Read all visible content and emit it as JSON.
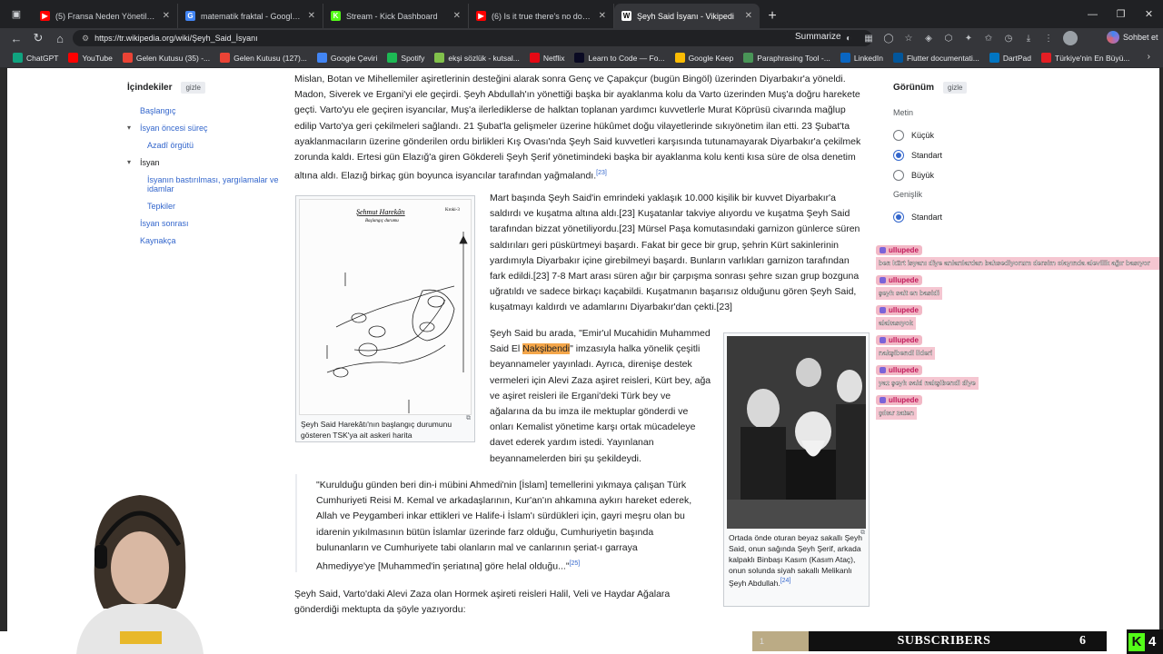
{
  "browser": {
    "tabs": [
      {
        "label": "(5) Fransa Neden Yönetilemiyor?",
        "favicon_color": "#ff0000",
        "favicon": "▶"
      },
      {
        "label": "matematik fraktal - Google'da Ar",
        "favicon_color": "#4285f4",
        "favicon": "G"
      },
      {
        "label": "Stream - Kick Dashboard",
        "favicon_color": "#53fc18",
        "favicon": "K"
      },
      {
        "label": "(6) Is it true there's no document",
        "favicon_color": "#ff0000",
        "favicon": "▶"
      },
      {
        "label": "Şeyh Said İsyanı - Vikipedi",
        "favicon_color": "#ffffff",
        "favicon": "W"
      }
    ],
    "url": "https://tr.wikipedia.org/wiki/Şeyh_Said_İsyanı",
    "summarize_label": "Summarize",
    "chat_label": "Sohbet et"
  },
  "bookmarks": [
    {
      "label": "ChatGPT",
      "color": "#10a37f"
    },
    {
      "label": "YouTube",
      "color": "#ff0000"
    },
    {
      "label": "Gelen Kutusu (35) -...",
      "color": "#ea4335"
    },
    {
      "label": "Gelen Kutusu (127)...",
      "color": "#ea4335"
    },
    {
      "label": "Google Çeviri",
      "color": "#4285f4"
    },
    {
      "label": "Spotify",
      "color": "#1db954"
    },
    {
      "label": "ekşi sözlük - kutsal...",
      "color": "#81c14b"
    },
    {
      "label": "Netflix",
      "color": "#e50914"
    },
    {
      "label": "Learn to Code — Fo...",
      "color": "#0a0a23"
    },
    {
      "label": "Google Keep",
      "color": "#fbbc04"
    },
    {
      "label": "Paraphrasing Tool -...",
      "color": "#499557"
    },
    {
      "label": "LinkedIn",
      "color": "#0a66c2"
    },
    {
      "label": "Flutter documentati...",
      "color": "#02569b"
    },
    {
      "label": "DartPad",
      "color": "#0175c2"
    },
    {
      "label": "Türkiye'nin En Büyü...",
      "color": "#e31e24"
    }
  ],
  "toc": {
    "title": "İçindekiler",
    "hide": "gizle",
    "items": [
      {
        "label": "Başlangıç",
        "level": 0
      },
      {
        "label": "İsyan öncesi süreç",
        "level": 0,
        "caret": "▾"
      },
      {
        "label": "Azadî örgütü",
        "level": 1
      },
      {
        "label": "İsyan",
        "level": 0,
        "caret": "▾"
      },
      {
        "label": "İsyanın bastırılması, yargılamalar ve idamlar",
        "level": 1
      },
      {
        "label": "Tepkiler",
        "level": 1
      },
      {
        "label": "İsyan sonrası",
        "level": 0
      },
      {
        "label": "Kaynakça",
        "level": 0
      }
    ]
  },
  "article": {
    "p1": "Mislan, Botan ve Mihellemiler aşiretlerinin desteğini alarak sonra Genç ve Çapakçur (bugün Bingöl) üzerinden Diyarbakır'a yöneldi. Madon, Siverek ve Ergani'yi ele geçirdi. Şeyh Abdullah'ın yönettiği başka bir ayaklanma kolu da Varto üzerinden Muş'a doğru harekete geçti. Varto'yu ele geçiren isyancılar, Muş'a ilerlediklerse de halktan toplanan yardımcı kuvvetlerle Murat Köprüsü civarında mağlup edilip Varto'ya geri çekilmeleri sağlandı. 21 Şubat'la gelişmeler üzerine hükûmet doğu vilayetlerinde sıkıyönetim ilan etti. 23 Şubat'ta ayaklanmacıların üzerine gönderilen ordu birlikleri Kış Ovası'nda Şeyh Said kuvvetleri karşısında tutunamayarak Diyarbakır'a çekilmek zorunda kaldı. Ertesi gün Elazığ'a giren Gökdereli Şeyh Şerif yönetimindeki başka bir ayaklanma kolu kenti kısa süre de olsa denetim altına aldı. Elazığ birkaç gün boyunca isyancılar tarafından yağmalandı.",
    "p1_ref": "[23]",
    "p2": "Mart başında Şeyh Said'in emrindeki yaklaşık 10.000 kişilik bir kuvvet Diyarbakır'a saldırdı ve kuşatma altına aldı.[23] Kuşatanlar takviye alıyordu ve kuşatma Şeyh Said tarafından bizzat yönetiliyordu.[23] Mürsel Paşa komutasındaki garnizon günlerce süren saldırıları geri püskürtmeyi başardı. Fakat bir gece bir grup, şehrin Kürt sakinlerinin yardımıyla Diyarbakır içine girebilmeyi başardı. Bunların varlıkları garnizon tarafından fark edildi.[23] 7-8 Mart arası süren ağır bir çarpışma sonrası şehre sızan grup bozguna uğratıldı ve sadece birkaçı kaçabildi. Kuşatmanın başarısız olduğunu gören Şeyh Said, kuşatmayı kaldırdı ve adamlarını Diyarbakır'dan çekti.[23]",
    "p3_pre": "Şeyh Said bu arada, \"Emir'ul Mucahidin Muhammed Said El ",
    "p3_hl": "Nakşibendi",
    "p3_post": "\" imzasıyla halka yönelik çeşitli beyannameler yayınladı. Ayrıca, direnişe destek vermeleri için Alevi Zaza aşiret reisleri, Kürt bey, ağa ve aşiret reisleri ile Ergani'deki Türk bey ve ağalarına da bu imza ile mektuplar gönderdi ve onları Kemalist yönetime karşı ortak mücadeleye davet ederek yardım istedi. Yayınlanan beyannamelerden biri şu şekildeydi.",
    "quote": "\"Kurulduğu günden beri din-i mübini Ahmedi'nin [İslam] temellerini yıkmaya çalışan Türk Cumhuriyeti Reisi M. Kemal ve arkadaşlarının, Kur'an'ın ahkamına aykırı hareket ederek, Allah ve Peygamberi inkar ettikleri ve Halife-i İslam'ı sürdükleri için, gayri meşru olan bu idarenin yıkılmasının bütün İslamlar üzerinde farz olduğu, Cumhuriyetin başında bulunanların ve Cumhuriyete tabi olanların mal ve canlarının şeriat-ı garraya Ahmediyye'ye [Muhammed'in şeriatına] göre helal olduğu...\"",
    "quote_ref": "[25]",
    "p4": "Şeyh Said, Varto'daki Alevi Zaza olan Hormek aşireti reisleri Halil, Veli ve Haydar Ağalara gönderdiği mektupta da şöyle yazıyordu:",
    "fig1_caption": "Şeyh Said Harekâtı'nın başlangıç durumunu gösteren TSK'ya ait askeri harita",
    "fig1_map_title": "Şehmut Harekâtı",
    "fig1_map_sub": "Başlangıç durumu",
    "fig1_map_num": "Kroki-3",
    "fig2_caption": "Ortada önde oturan beyaz sakallı Şeyh Said, onun sağında Şeyh Şerif, arkada kalpaklı Binbaşı Kasım (Kasım Ataç), onun solunda siyah sakallı Melikanlı Şeyh Abdullah.",
    "fig2_ref": "[24]"
  },
  "appearance": {
    "title": "Görünüm",
    "hide": "gizle",
    "text_section": "Metin",
    "text_options": [
      {
        "label": "Küçük",
        "selected": false
      },
      {
        "label": "Standart",
        "selected": true
      },
      {
        "label": "Büyük",
        "selected": false
      }
    ],
    "width_section": "Genişlik",
    "width_options": [
      {
        "label": "Standart",
        "selected": true
      }
    ]
  },
  "chat": {
    "user": "ullupede",
    "messages": [
      "ben kürt isyanı diye anlarılardan bahsediyorum dersim olayında alevilik ağır basıyor",
      "şeyh sait en basidi",
      "alakasıyok",
      "nakşibendi lideri",
      "yaz şeyh said nakşibendi diye",
      "çıkar zaten"
    ]
  },
  "overlay": {
    "subscribers_label": "SUBSCRIBERS",
    "subscribers_count": "6",
    "progress_value": "1",
    "kick_count": "4"
  }
}
